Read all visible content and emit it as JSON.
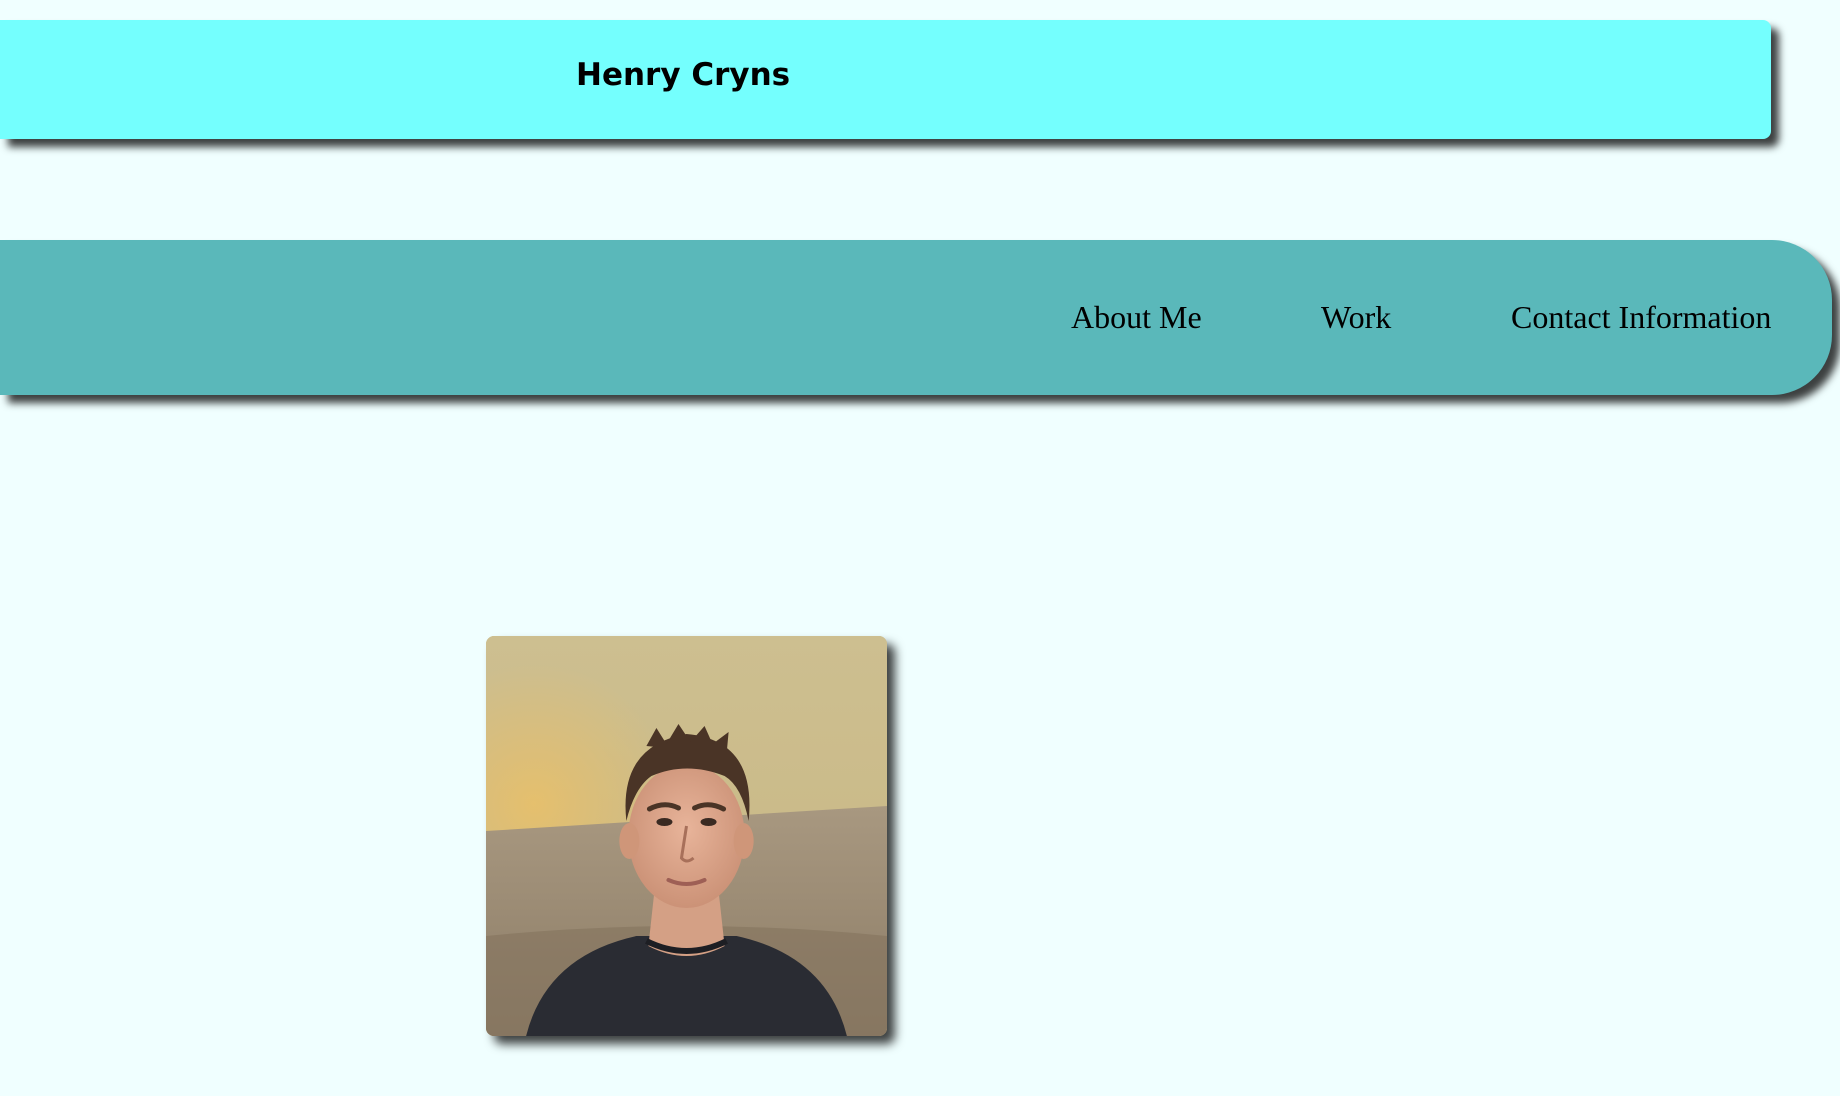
{
  "header": {
    "title": "Henry Cryns"
  },
  "nav": {
    "items": [
      {
        "label": "About Me"
      },
      {
        "label": "Work"
      },
      {
        "label": "Contact Information"
      }
    ]
  },
  "profile": {
    "photo_subject": "portrait photo of a man in a dark t-shirt seated on a tan couch"
  },
  "colors": {
    "page_background": "#f0ffff",
    "header_background": "#74fffe",
    "nav_background": "#5ab8ba",
    "text": "#000000"
  }
}
